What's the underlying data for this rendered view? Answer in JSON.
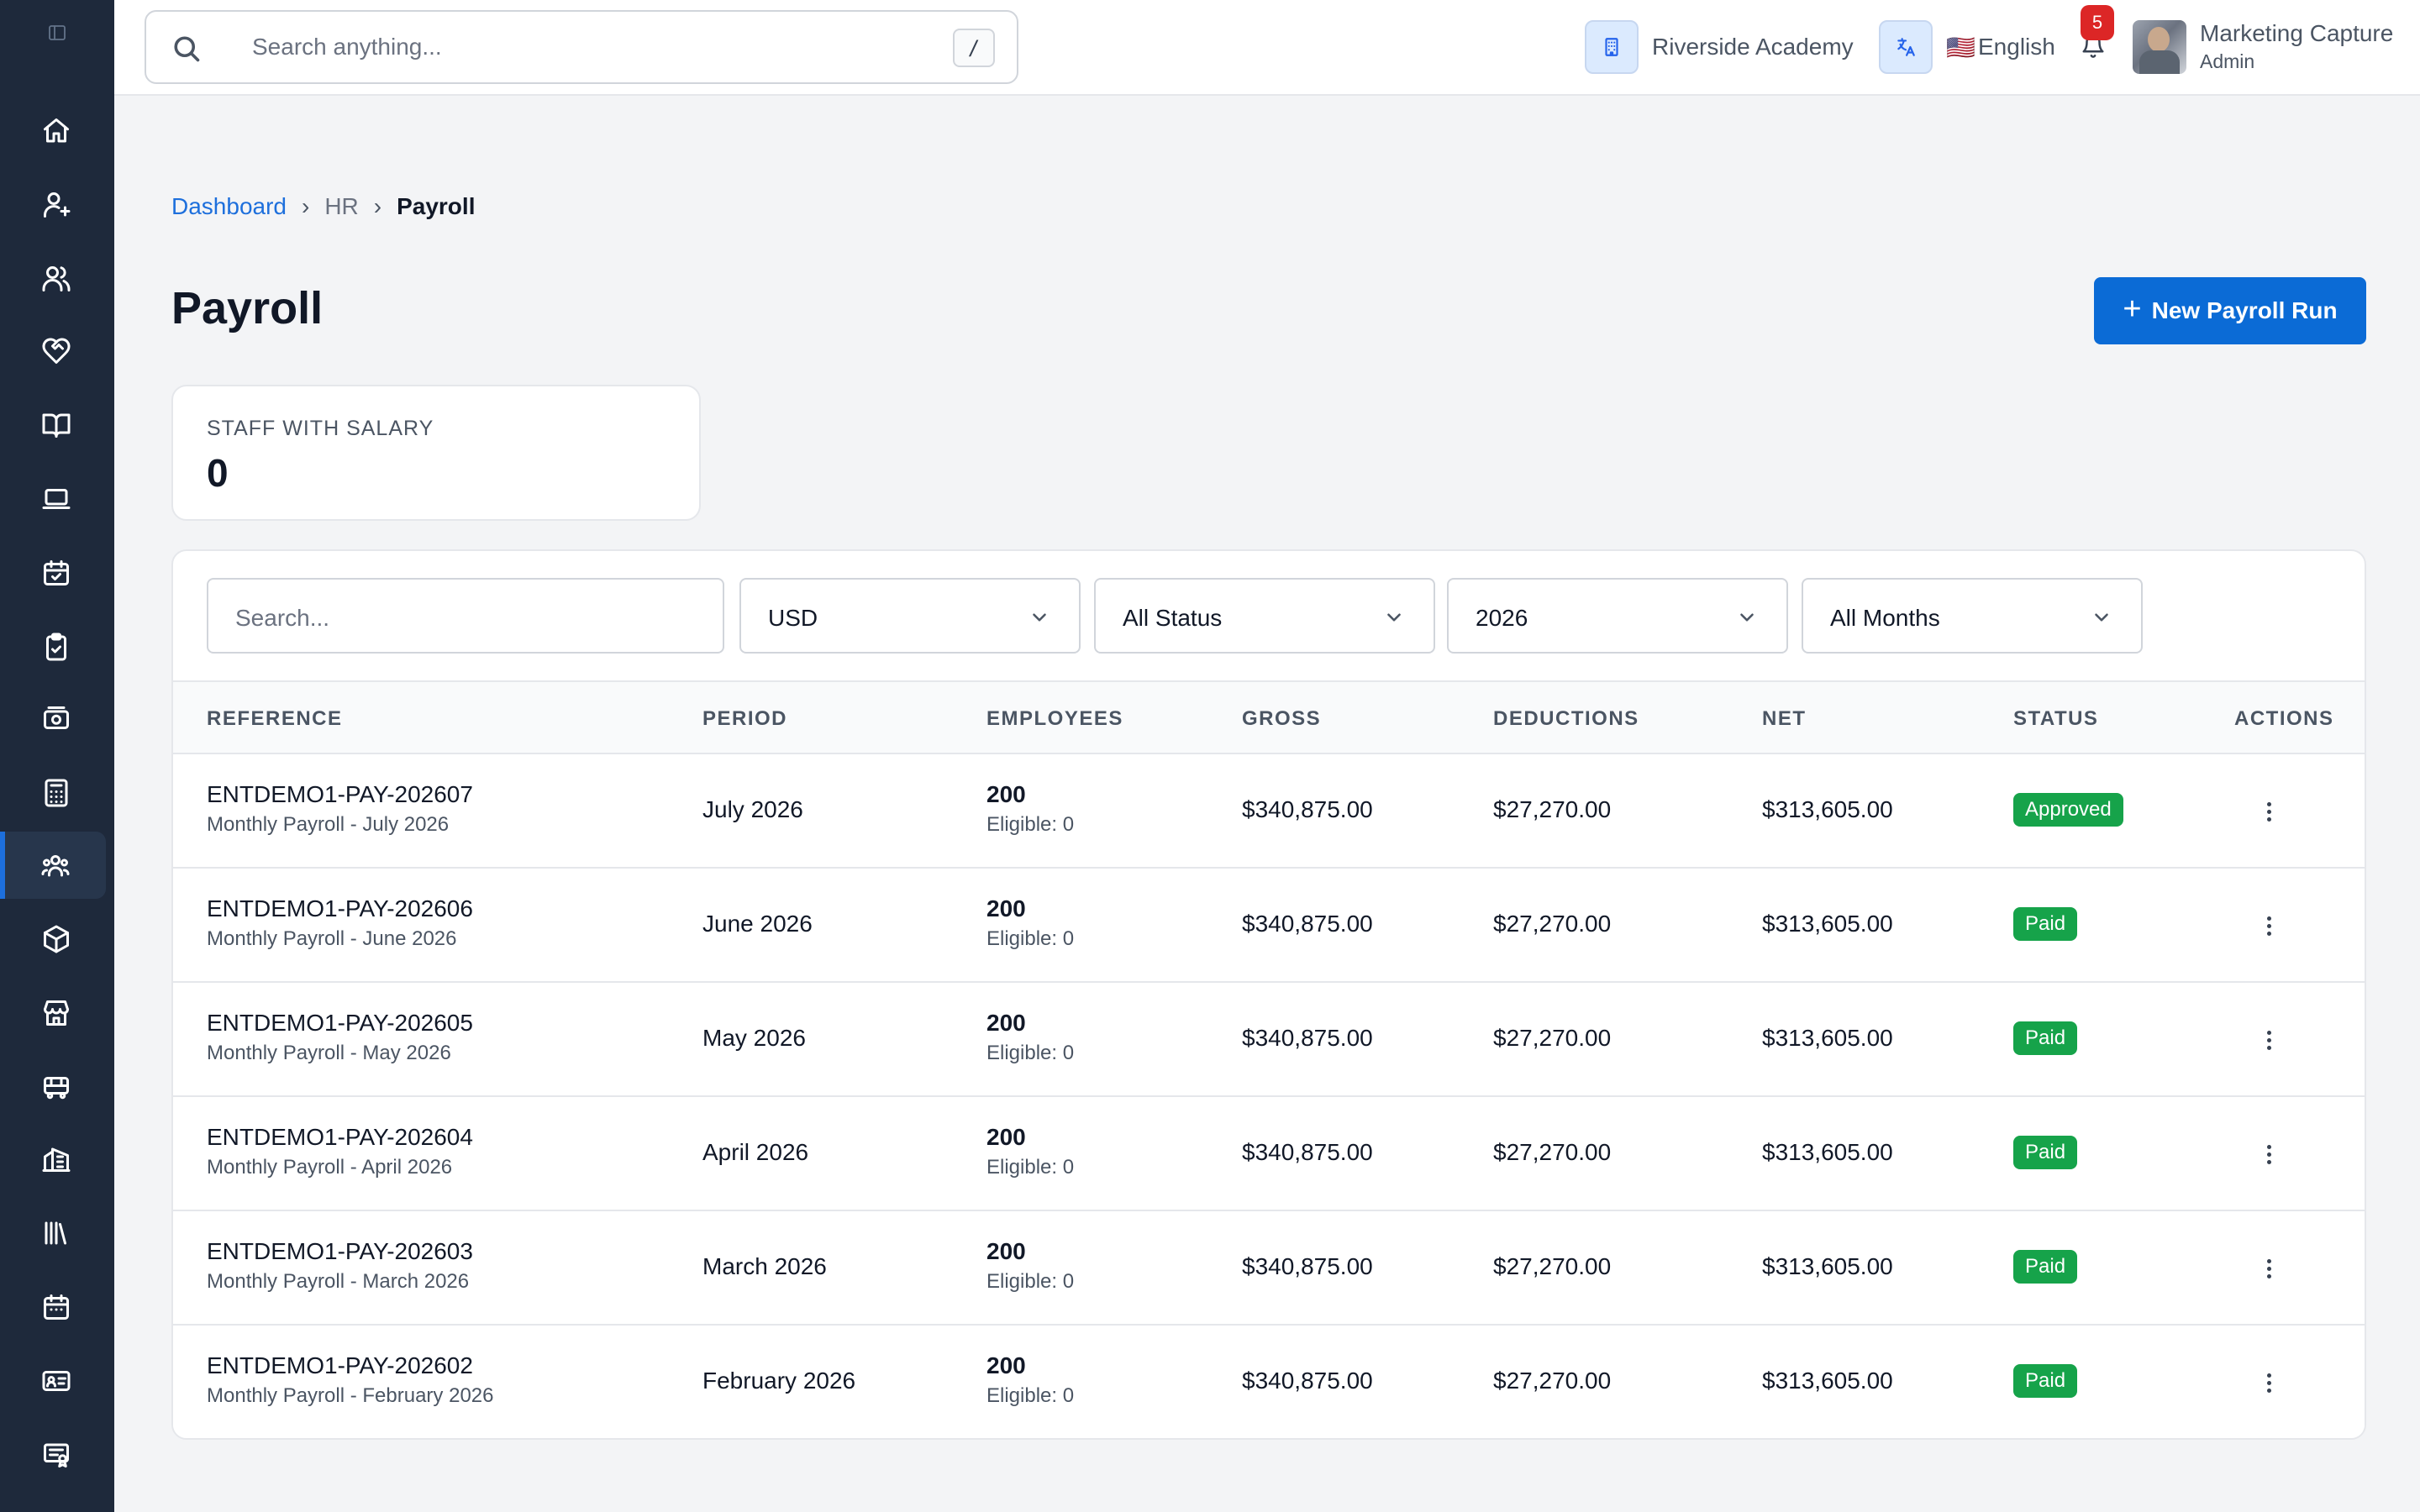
{
  "topbar": {
    "search_placeholder": "Search anything...",
    "search_shortcut": "/",
    "school": "Riverside Academy",
    "language": "English",
    "language_flag": "🇺🇸",
    "notifications_count": "5",
    "user_name": "Marketing Capture",
    "user_role": "Admin"
  },
  "sidebar": {
    "items": [
      {
        "icon": "home-icon"
      },
      {
        "icon": "user-plus-icon"
      },
      {
        "icon": "users-icon"
      },
      {
        "icon": "heart-handshake-icon"
      },
      {
        "icon": "book-open-icon"
      },
      {
        "icon": "laptop-icon"
      },
      {
        "icon": "calendar-check-icon"
      },
      {
        "icon": "clipboard-check-icon"
      },
      {
        "icon": "banknote-icon"
      },
      {
        "icon": "calculator-icon"
      },
      {
        "icon": "user-group-icon",
        "active": true
      },
      {
        "icon": "package-icon"
      },
      {
        "icon": "store-icon"
      },
      {
        "icon": "bus-icon"
      },
      {
        "icon": "building-icon"
      },
      {
        "icon": "library-icon"
      },
      {
        "icon": "calendar-icon"
      },
      {
        "icon": "id-card-icon"
      },
      {
        "icon": "certificate-icon"
      }
    ]
  },
  "breadcrumb": {
    "home": "Dashboard",
    "sep1": "›",
    "section": "HR",
    "sep2": "›",
    "current": "Payroll"
  },
  "page": {
    "title": "Payroll",
    "new_button": "New Payroll Run",
    "new_button_icon": "+"
  },
  "stats": {
    "label": "STAFF WITH SALARY",
    "value": "0"
  },
  "filters": {
    "search_placeholder": "Search...",
    "currency": "USD",
    "status": "All Status",
    "year": "2026",
    "month": "All Months"
  },
  "table": {
    "headers": {
      "reference": "REFERENCE",
      "period": "PERIOD",
      "employees": "EMPLOYEES",
      "gross": "GROSS",
      "deductions": "DEDUCTIONS",
      "net": "NET",
      "status": "STATUS",
      "actions": "ACTIONS"
    },
    "rows": [
      {
        "ref": "ENTDEMO1-PAY-202607",
        "desc": "Monthly Payroll - July 2026",
        "period": "July 2026",
        "employees": "200",
        "eligible": "Eligible: 0",
        "gross": "$340,875.00",
        "deductions": "$27,270.00",
        "net": "$313,605.00",
        "status": "Approved"
      },
      {
        "ref": "ENTDEMO1-PAY-202606",
        "desc": "Monthly Payroll - June 2026",
        "period": "June 2026",
        "employees": "200",
        "eligible": "Eligible: 0",
        "gross": "$340,875.00",
        "deductions": "$27,270.00",
        "net": "$313,605.00",
        "status": "Paid"
      },
      {
        "ref": "ENTDEMO1-PAY-202605",
        "desc": "Monthly Payroll - May 2026",
        "period": "May 2026",
        "employees": "200",
        "eligible": "Eligible: 0",
        "gross": "$340,875.00",
        "deductions": "$27,270.00",
        "net": "$313,605.00",
        "status": "Paid"
      },
      {
        "ref": "ENTDEMO1-PAY-202604",
        "desc": "Monthly Payroll - April 2026",
        "period": "April 2026",
        "employees": "200",
        "eligible": "Eligible: 0",
        "gross": "$340,875.00",
        "deductions": "$27,270.00",
        "net": "$313,605.00",
        "status": "Paid"
      },
      {
        "ref": "ENTDEMO1-PAY-202603",
        "desc": "Monthly Payroll - March 2026",
        "period": "March 2026",
        "employees": "200",
        "eligible": "Eligible: 0",
        "gross": "$340,875.00",
        "deductions": "$27,270.00",
        "net": "$313,605.00",
        "status": "Paid"
      },
      {
        "ref": "ENTDEMO1-PAY-202602",
        "desc": "Monthly Payroll - February 2026",
        "period": "February 2026",
        "employees": "200",
        "eligible": "Eligible: 0",
        "gross": "$340,875.00",
        "deductions": "$27,270.00",
        "net": "$313,605.00",
        "status": "Paid"
      }
    ]
  },
  "colors": {
    "sidebar": "#1e293b",
    "primary": "#0b6bd6",
    "status_green": "#16a34a",
    "badge_red": "#dc2626"
  }
}
